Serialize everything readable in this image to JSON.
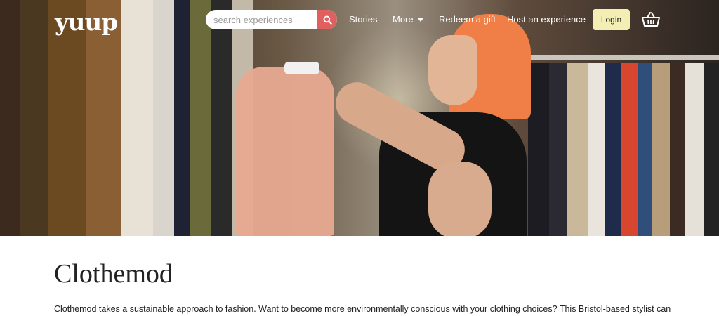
{
  "header": {
    "logo": "yuup",
    "search": {
      "placeholder": "search experiences"
    },
    "nav": {
      "stories": "Stories",
      "more": "More",
      "redeem": "Redeem a gift",
      "host": "Host an experience"
    },
    "login_label": "Login"
  },
  "hero": {
    "image_alt": "Woman with orange hair holding a pink garment in a clothing store"
  },
  "main": {
    "title": "Clothemod",
    "description": "Clothemod takes a sustainable approach to fashion. Want to become more environmentally conscious with your clothing choices? This Bristol-based stylist can"
  },
  "colors": {
    "search_button": "#e0605f",
    "login_button": "#f3eeb3",
    "hair_accent": "#ef7e47"
  },
  "icons": {
    "search": "search-icon",
    "basket": "basket-icon",
    "more_caret": "chevron-down-icon"
  }
}
